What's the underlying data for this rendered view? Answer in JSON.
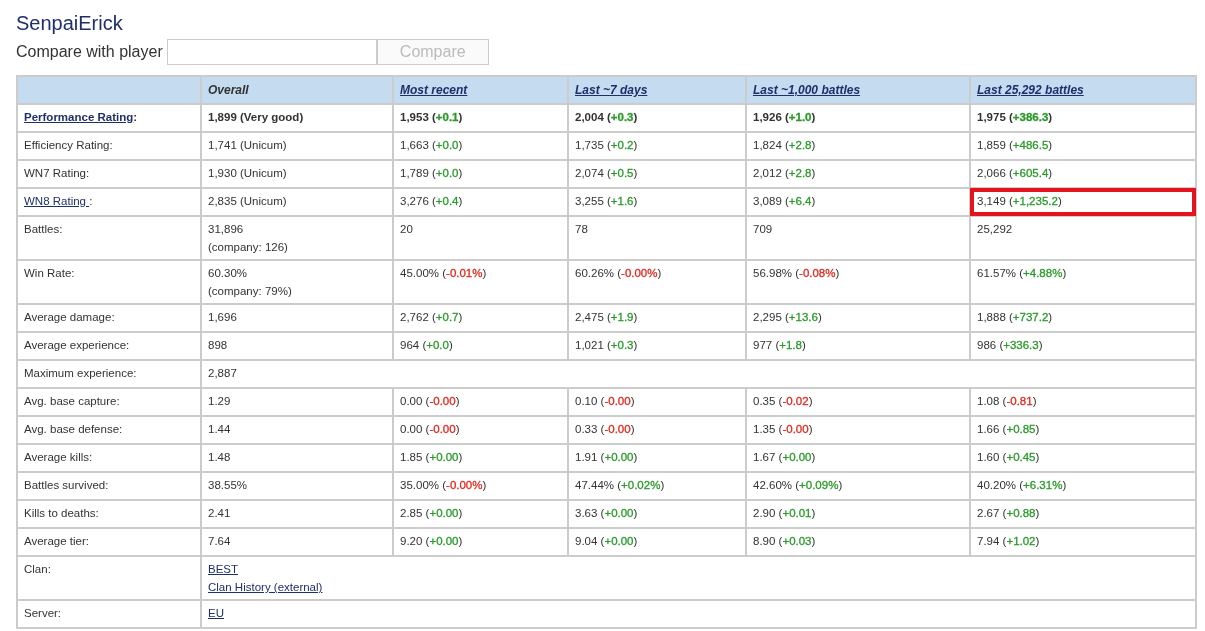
{
  "player": {
    "name": "SenpaiErick"
  },
  "compare": {
    "label": "Compare with player",
    "button": "Compare",
    "button_disabled": true
  },
  "columns": [
    {
      "label": "Overall"
    },
    {
      "label": "Most recent",
      "link": true
    },
    {
      "label": "Last ~7 days",
      "link": true
    },
    {
      "label": "Last ~1,000 battles",
      "link": true
    },
    {
      "label": "Last 25,292 battles",
      "link": true
    }
  ],
  "rows": [
    {
      "kind": "stats",
      "label": "Performance Rating",
      "label_link": true,
      "suffix": ":",
      "bold": true,
      "overall": {
        "value": "1,899 (Very good)"
      },
      "cells": [
        {
          "value": "1,953",
          "change": "(+0.1)",
          "color": "#2a9a2a"
        },
        {
          "value": "2,004",
          "change": "(+0.3)",
          "color": "#2a9a2a"
        },
        {
          "value": "1,926",
          "change": "(+1.0)",
          "color": "#2a9a2a"
        },
        {
          "value": "1,975",
          "change": "(+386.3)",
          "color": "#2a9a2a"
        }
      ]
    },
    {
      "kind": "stats",
      "label": "Efficiency Rating:",
      "overall": {
        "value": "1,741 (Unicum)"
      },
      "cells": [
        {
          "value": "1,663",
          "change": "(+0.0)",
          "color": "#2a9a2a"
        },
        {
          "value": "1,735",
          "change": "(+0.2)",
          "color": "#2a9a2a"
        },
        {
          "value": "1,824",
          "change": "(+2.8)",
          "color": "#2a9a2a"
        },
        {
          "value": "1,859",
          "change": "(+486.5)",
          "color": "#2a9a2a"
        }
      ]
    },
    {
      "kind": "stats",
      "label": "WN7 Rating:",
      "overall": {
        "value": "1,930 (Unicum)"
      },
      "cells": [
        {
          "value": "1,789",
          "change": "(+0.0)",
          "color": "#2a9a2a"
        },
        {
          "value": "2,074",
          "change": "(+0.5)",
          "color": "#2a9a2a"
        },
        {
          "value": "2,012",
          "change": "(+2.8)",
          "color": "#2a9a2a"
        },
        {
          "value": "2,066",
          "change": "(+605.4)",
          "color": "#2a9a2a"
        }
      ]
    },
    {
      "kind": "stats",
      "label": "WN8 Rating ",
      "label_link": true,
      "suffix": ":",
      "overall": {
        "value": "2,835 (Unicum)"
      },
      "cells": [
        {
          "value": "3,276",
          "change": "(+0.4)",
          "color": "#2a9a2a"
        },
        {
          "value": "3,255",
          "change": "(+1.6)",
          "color": "#2a9a2a"
        },
        {
          "value": "3,089",
          "change": "(+6.4)",
          "color": "#2a9a2a"
        },
        {
          "value": "3,149",
          "change": "(+1,235.2)",
          "color": "#2a9a2a",
          "highlighted": true
        }
      ]
    },
    {
      "kind": "stats",
      "label": "Battles:",
      "overall": {
        "value": "31,896",
        "note": "(company: 126)"
      },
      "cells": [
        {
          "value": "20"
        },
        {
          "value": "78"
        },
        {
          "value": "709"
        },
        {
          "value": "25,292"
        }
      ]
    },
    {
      "kind": "stats",
      "label": "Win Rate:",
      "overall": {
        "value": "60.30%",
        "note": "(company: 79%)"
      },
      "cells": [
        {
          "value": "45.00%",
          "change": "(-0.01%)",
          "color": "#e0281e"
        },
        {
          "value": "60.26%",
          "change": "(-0.00%)",
          "color": "#e0281e"
        },
        {
          "value": "56.98%",
          "change": "(-0.08%)",
          "color": "#e0281e"
        },
        {
          "value": "61.57%",
          "change": "(+4.88%)",
          "color": "#2a9a2a"
        }
      ]
    },
    {
      "kind": "stats",
      "label": "Average damage:",
      "overall": {
        "value": "1,696"
      },
      "cells": [
        {
          "value": "2,762",
          "change": "(+0.7)",
          "color": "#2a9a2a"
        },
        {
          "value": "2,475",
          "change": "(+1.9)",
          "color": "#2a9a2a"
        },
        {
          "value": "2,295",
          "change": "(+13.6)",
          "color": "#2a9a2a"
        },
        {
          "value": "1,888",
          "change": "(+737.2)",
          "color": "#2a9a2a"
        }
      ]
    },
    {
      "kind": "stats",
      "label": "Average experience:",
      "overall": {
        "value": "898"
      },
      "cells": [
        {
          "value": "964",
          "change": "(+0.0)",
          "color": "#2a9a2a"
        },
        {
          "value": "1,021",
          "change": "(+0.3)",
          "color": "#2a9a2a"
        },
        {
          "value": "977",
          "change": "(+1.8)",
          "color": "#2a9a2a"
        },
        {
          "value": "986",
          "change": "(+336.3)",
          "color": "#2a9a2a"
        }
      ]
    },
    {
      "kind": "span",
      "label": "Maximum experience:",
      "lines": [
        {
          "text": "2,887"
        }
      ]
    },
    {
      "kind": "stats",
      "label": "Avg. base capture:",
      "overall": {
        "value": "1.29"
      },
      "cells": [
        {
          "value": "0.00",
          "change": "(-0.00)",
          "color": "#e0281e"
        },
        {
          "value": "0.10",
          "change": "(-0.00)",
          "color": "#e0281e"
        },
        {
          "value": "0.35",
          "change": "(-0.02)",
          "color": "#e0281e"
        },
        {
          "value": "1.08",
          "change": "(-0.81)",
          "color": "#e0281e"
        }
      ]
    },
    {
      "kind": "stats",
      "label": "Avg. base defense:",
      "overall": {
        "value": "1.44"
      },
      "cells": [
        {
          "value": "0.00",
          "change": "(-0.00)",
          "color": "#e0281e"
        },
        {
          "value": "0.33",
          "change": "(-0.00)",
          "color": "#e0281e"
        },
        {
          "value": "1.35",
          "change": "(-0.00)",
          "color": "#e0281e"
        },
        {
          "value": "1.66",
          "change": "(+0.85)",
          "color": "#2a9a2a"
        }
      ]
    },
    {
      "kind": "stats",
      "label": "Average kills:",
      "overall": {
        "value": "1.48"
      },
      "cells": [
        {
          "value": "1.85",
          "change": "(+0.00)",
          "color": "#2a9a2a"
        },
        {
          "value": "1.91",
          "change": "(+0.00)",
          "color": "#2a9a2a"
        },
        {
          "value": "1.67",
          "change": "(+0.00)",
          "color": "#2a9a2a"
        },
        {
          "value": "1.60",
          "change": "(+0.45)",
          "color": "#2a9a2a"
        }
      ]
    },
    {
      "kind": "stats",
      "label": "Battles survived:",
      "overall": {
        "value": "38.55%"
      },
      "cells": [
        {
          "value": "35.00%",
          "change": "(-0.00%)",
          "color": "#e0281e"
        },
        {
          "value": "47.44%",
          "change": "(+0.02%)",
          "color": "#2a9a2a"
        },
        {
          "value": "42.60%",
          "change": "(+0.09%)",
          "color": "#2a9a2a"
        },
        {
          "value": "40.20%",
          "change": "(+6.31%)",
          "color": "#2a9a2a"
        }
      ]
    },
    {
      "kind": "stats",
      "label": "Kills to deaths:",
      "overall": {
        "value": "2.41"
      },
      "cells": [
        {
          "value": "2.85",
          "change": "(+0.00)",
          "color": "#2a9a2a"
        },
        {
          "value": "3.63",
          "change": "(+0.00)",
          "color": "#2a9a2a"
        },
        {
          "value": "2.90",
          "change": "(+0.01)",
          "color": "#2a9a2a"
        },
        {
          "value": "2.67",
          "change": "(+0.88)",
          "color": "#2a9a2a"
        }
      ]
    },
    {
      "kind": "stats",
      "label": "Average tier:",
      "overall": {
        "value": "7.64"
      },
      "cells": [
        {
          "value": "9.20",
          "change": "(+0.00)",
          "color": "#2a9a2a"
        },
        {
          "value": "9.04",
          "change": "(+0.00)",
          "color": "#2a9a2a"
        },
        {
          "value": "8.90",
          "change": "(+0.03)",
          "color": "#2a9a2a"
        },
        {
          "value": "7.94",
          "change": "(+1.02)",
          "color": "#2a9a2a"
        }
      ]
    },
    {
      "kind": "span",
      "label": "Clan:",
      "lines": [
        {
          "text": "BEST",
          "link": true
        },
        {
          "text": "Clan History (external)",
          "link": true
        }
      ]
    },
    {
      "kind": "span",
      "label": "Server:",
      "lines": [
        {
          "text": "EU",
          "link": true
        }
      ]
    }
  ]
}
